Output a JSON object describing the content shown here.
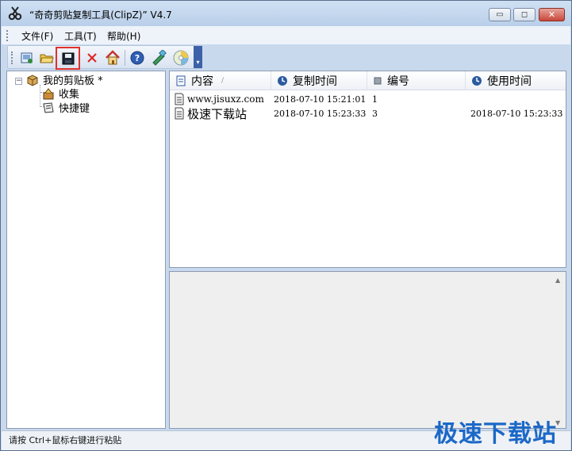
{
  "window": {
    "title": "“奇奇剪贴复制工具(ClipZ)” V4.7",
    "minimize_glyph": "▭",
    "maximize_glyph": "◻",
    "close_glyph": "✕"
  },
  "menu": {
    "items": [
      {
        "label": "文件(F)"
      },
      {
        "label": "工具(T)"
      },
      {
        "label": "帮助(H)"
      }
    ]
  },
  "toolbar": {
    "buttons": [
      {
        "icon": "new-clip-icon"
      },
      {
        "icon": "open-folder-icon"
      },
      {
        "icon": "save-icon",
        "selected": true
      },
      {
        "icon": "delete-icon"
      },
      {
        "icon": "home-icon"
      },
      {
        "icon": "help-icon"
      },
      {
        "icon": "tools-icon"
      },
      {
        "icon": "disc-icon"
      }
    ],
    "overflow_glyph": "▾"
  },
  "tree": {
    "root": {
      "label": "我的剪贴板 *",
      "expander": "−"
    },
    "children": [
      {
        "label": "收集"
      },
      {
        "label": "快捷键"
      }
    ]
  },
  "list": {
    "columns": [
      {
        "label": "内容",
        "sort": "∕"
      },
      {
        "label": "复制时间"
      },
      {
        "label": "编号"
      },
      {
        "label": "使用时间"
      }
    ],
    "rows": [
      {
        "content": "www.jisuxz.com",
        "copy_time": "2018-07-10 15:21:01",
        "number": "1",
        "use_time": ""
      },
      {
        "content": "极速下载站",
        "copy_time": "2018-07-10 15:23:33",
        "number": "3",
        "use_time": "2018-07-10 15:23:33"
      }
    ]
  },
  "preview": {
    "scroll_up_glyph": "▲",
    "scroll_down_glyph": "▼"
  },
  "status": {
    "text": "请按 Ctrl+鼠标右键进行粘贴"
  },
  "watermark": {
    "text": "极速下载站"
  },
  "colors": {
    "titlebar": "#c8d9ee",
    "highlight": "#e0312c",
    "watermark": "#1c68c7"
  }
}
